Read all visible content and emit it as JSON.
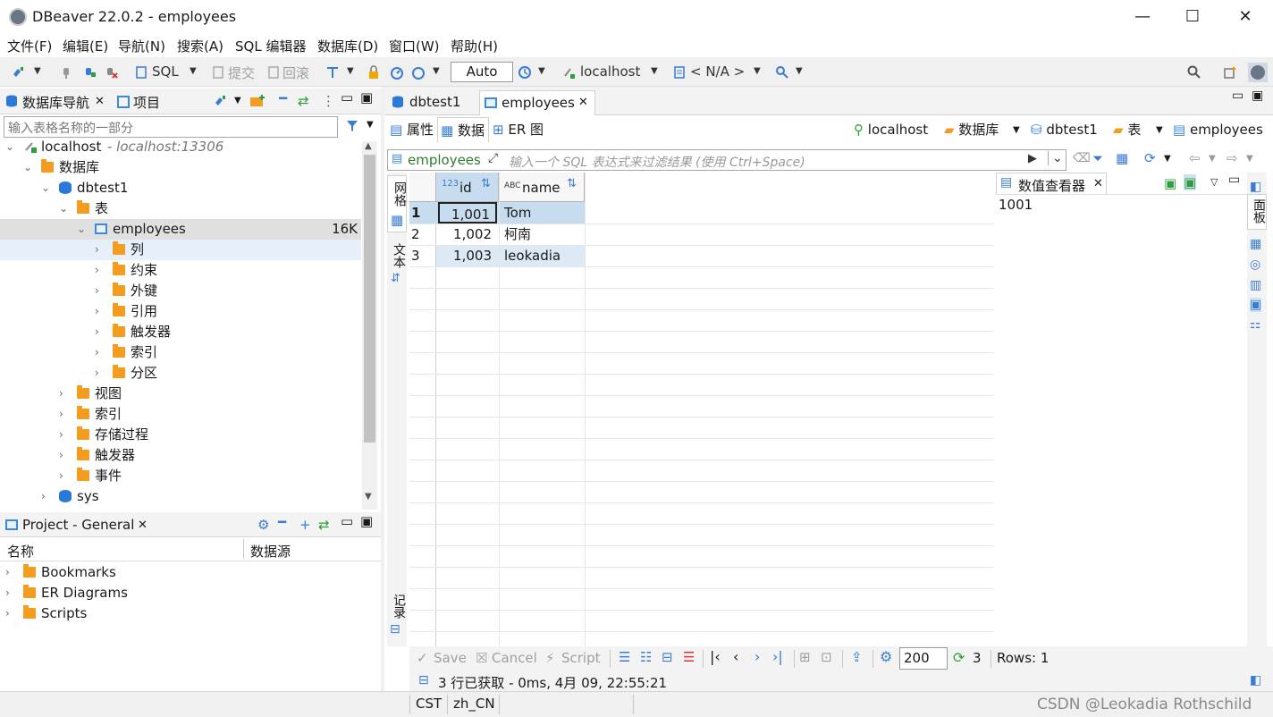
{
  "window": {
    "title": "DBeaver 22.0.2 - employees",
    "minimize": "—",
    "maximize": "☐",
    "close": "✕"
  },
  "menu": [
    "文件(F)",
    "编辑(E)",
    "导航(N)",
    "搜索(A)",
    "SQL 编辑器",
    "数据库(D)",
    "窗口(W)",
    "帮助(H)"
  ],
  "toolbar": {
    "sql": "SQL",
    "commit": "提交",
    "rollback": "回滚",
    "auto": "Auto",
    "host": "localhost",
    "schema": "< N/A >"
  },
  "navigator": {
    "tab1": "数据库导航",
    "tab2": "项目",
    "filter_placeholder": "输入表格名称的一部分",
    "localhost": "localhost",
    "localhost_info": "- localhost:13306",
    "databases": "数据库",
    "dbtest1": "dbtest1",
    "tables": "表",
    "employees": "employees",
    "employees_size": "16K",
    "children": [
      "列",
      "约束",
      "外键",
      "引用",
      "触发器",
      "索引",
      "分区"
    ],
    "db_children": [
      "视图",
      "索引",
      "存储过程",
      "触发器",
      "事件"
    ],
    "sys": "sys"
  },
  "project": {
    "title": "Project - General",
    "col_name": "名称",
    "col_source": "数据源",
    "items": [
      "Bookmarks",
      "ER Diagrams",
      "Scripts"
    ]
  },
  "editor": {
    "tabs": [
      "dbtest1",
      "employees"
    ],
    "subtabs": [
      "属性",
      "数据",
      "ER 图"
    ],
    "breadcrumb": [
      "localhost",
      "数据库",
      "dbtest1",
      "表",
      "employees"
    ],
    "filter_table": "employees",
    "filter_placeholder": "输入一个 SQL 表达式来过滤结果 (使用 Ctrl+Space)",
    "vtab_grid": "网格",
    "vtab_text": "文本",
    "vtab_record": "记录",
    "columns": [
      {
        "type": "123",
        "name": "id"
      },
      {
        "type": "ABC",
        "name": "name"
      }
    ],
    "rows": [
      {
        "num": "1",
        "id": "1,001",
        "name": "Tom"
      },
      {
        "num": "2",
        "id": "1,002",
        "name": "柯南"
      },
      {
        "num": "3",
        "id": "1,003",
        "name": "leokadia"
      }
    ],
    "value_viewer_title": "数值查看器",
    "value_viewer_value": "1001",
    "panel_label": "面板"
  },
  "bottom": {
    "save": "Save",
    "cancel": "Cancel",
    "script": "Script",
    "page_size": "200",
    "refresh_count": "3",
    "rows": "Rows: 1",
    "status": "3 行已获取 - 0ms, 4月 09, 22:55:21"
  },
  "statusbar": {
    "tz": "CST",
    "locale": "zh_CN",
    "watermark": "CSDN @Leokadia Rothschild"
  }
}
